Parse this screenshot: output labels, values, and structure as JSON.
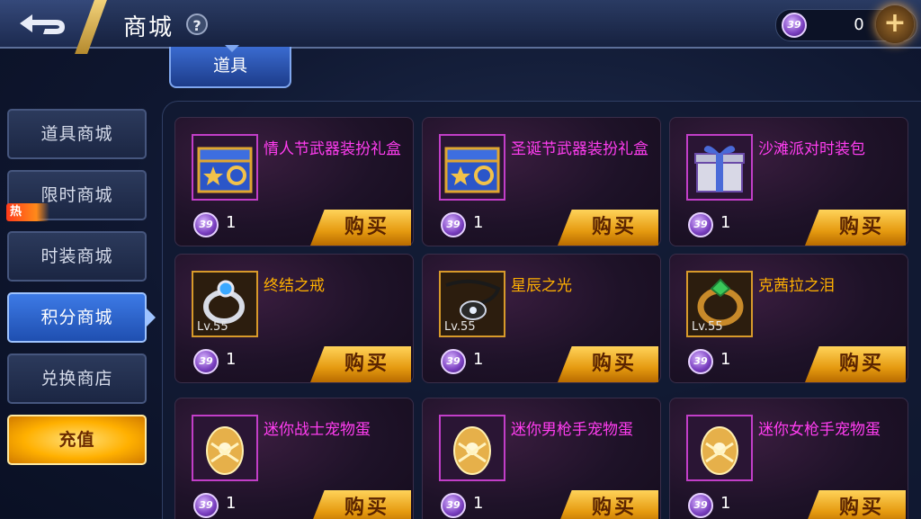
{
  "header": {
    "title": "商城",
    "help_symbol": "?",
    "currency_amount": "0",
    "plus_symbol": "+"
  },
  "coin_label": "39",
  "category_tab": {
    "label": "道具"
  },
  "sidebar": {
    "items": [
      {
        "label": "道具商城"
      },
      {
        "label": "限时商城"
      },
      {
        "label": "时装商城"
      },
      {
        "label": "积分商城"
      },
      {
        "label": "兑换商店"
      },
      {
        "label": "充值"
      }
    ],
    "hot_badge": "热"
  },
  "buy_label": "购买",
  "items": [
    {
      "name": "情人节武器装扮礼盒",
      "price": "1",
      "icon": "chest-icon",
      "rarity_color": "#ff3df0"
    },
    {
      "name": "圣诞节武器装扮礼盒",
      "price": "1",
      "icon": "chest-icon",
      "rarity_color": "#ff3df0"
    },
    {
      "name": "沙滩派对时装包",
      "price": "1",
      "icon": "gift-box-icon",
      "rarity_color": "#ff3df0"
    },
    {
      "name": "终结之戒",
      "price": "1",
      "level": "Lv.55",
      "icon": "ring-icon",
      "rarity_color": "#ffb000"
    },
    {
      "name": "星辰之光",
      "price": "1",
      "level": "Lv.55",
      "icon": "necklace-icon",
      "rarity_color": "#ffb000"
    },
    {
      "name": "克茜拉之泪",
      "price": "1",
      "level": "Lv.55",
      "icon": "gem-ring-icon",
      "rarity_color": "#ffb000"
    },
    {
      "name": "迷你战士宠物蛋",
      "price": "1",
      "icon": "pet-egg-icon",
      "rarity_color": "#ff3df0"
    },
    {
      "name": "迷你男枪手宠物蛋",
      "price": "1",
      "icon": "pet-egg-icon",
      "rarity_color": "#ff3df0"
    },
    {
      "name": "迷你女枪手宠物蛋",
      "price": "1",
      "icon": "pet-egg-icon",
      "rarity_color": "#ff3df0"
    }
  ]
}
